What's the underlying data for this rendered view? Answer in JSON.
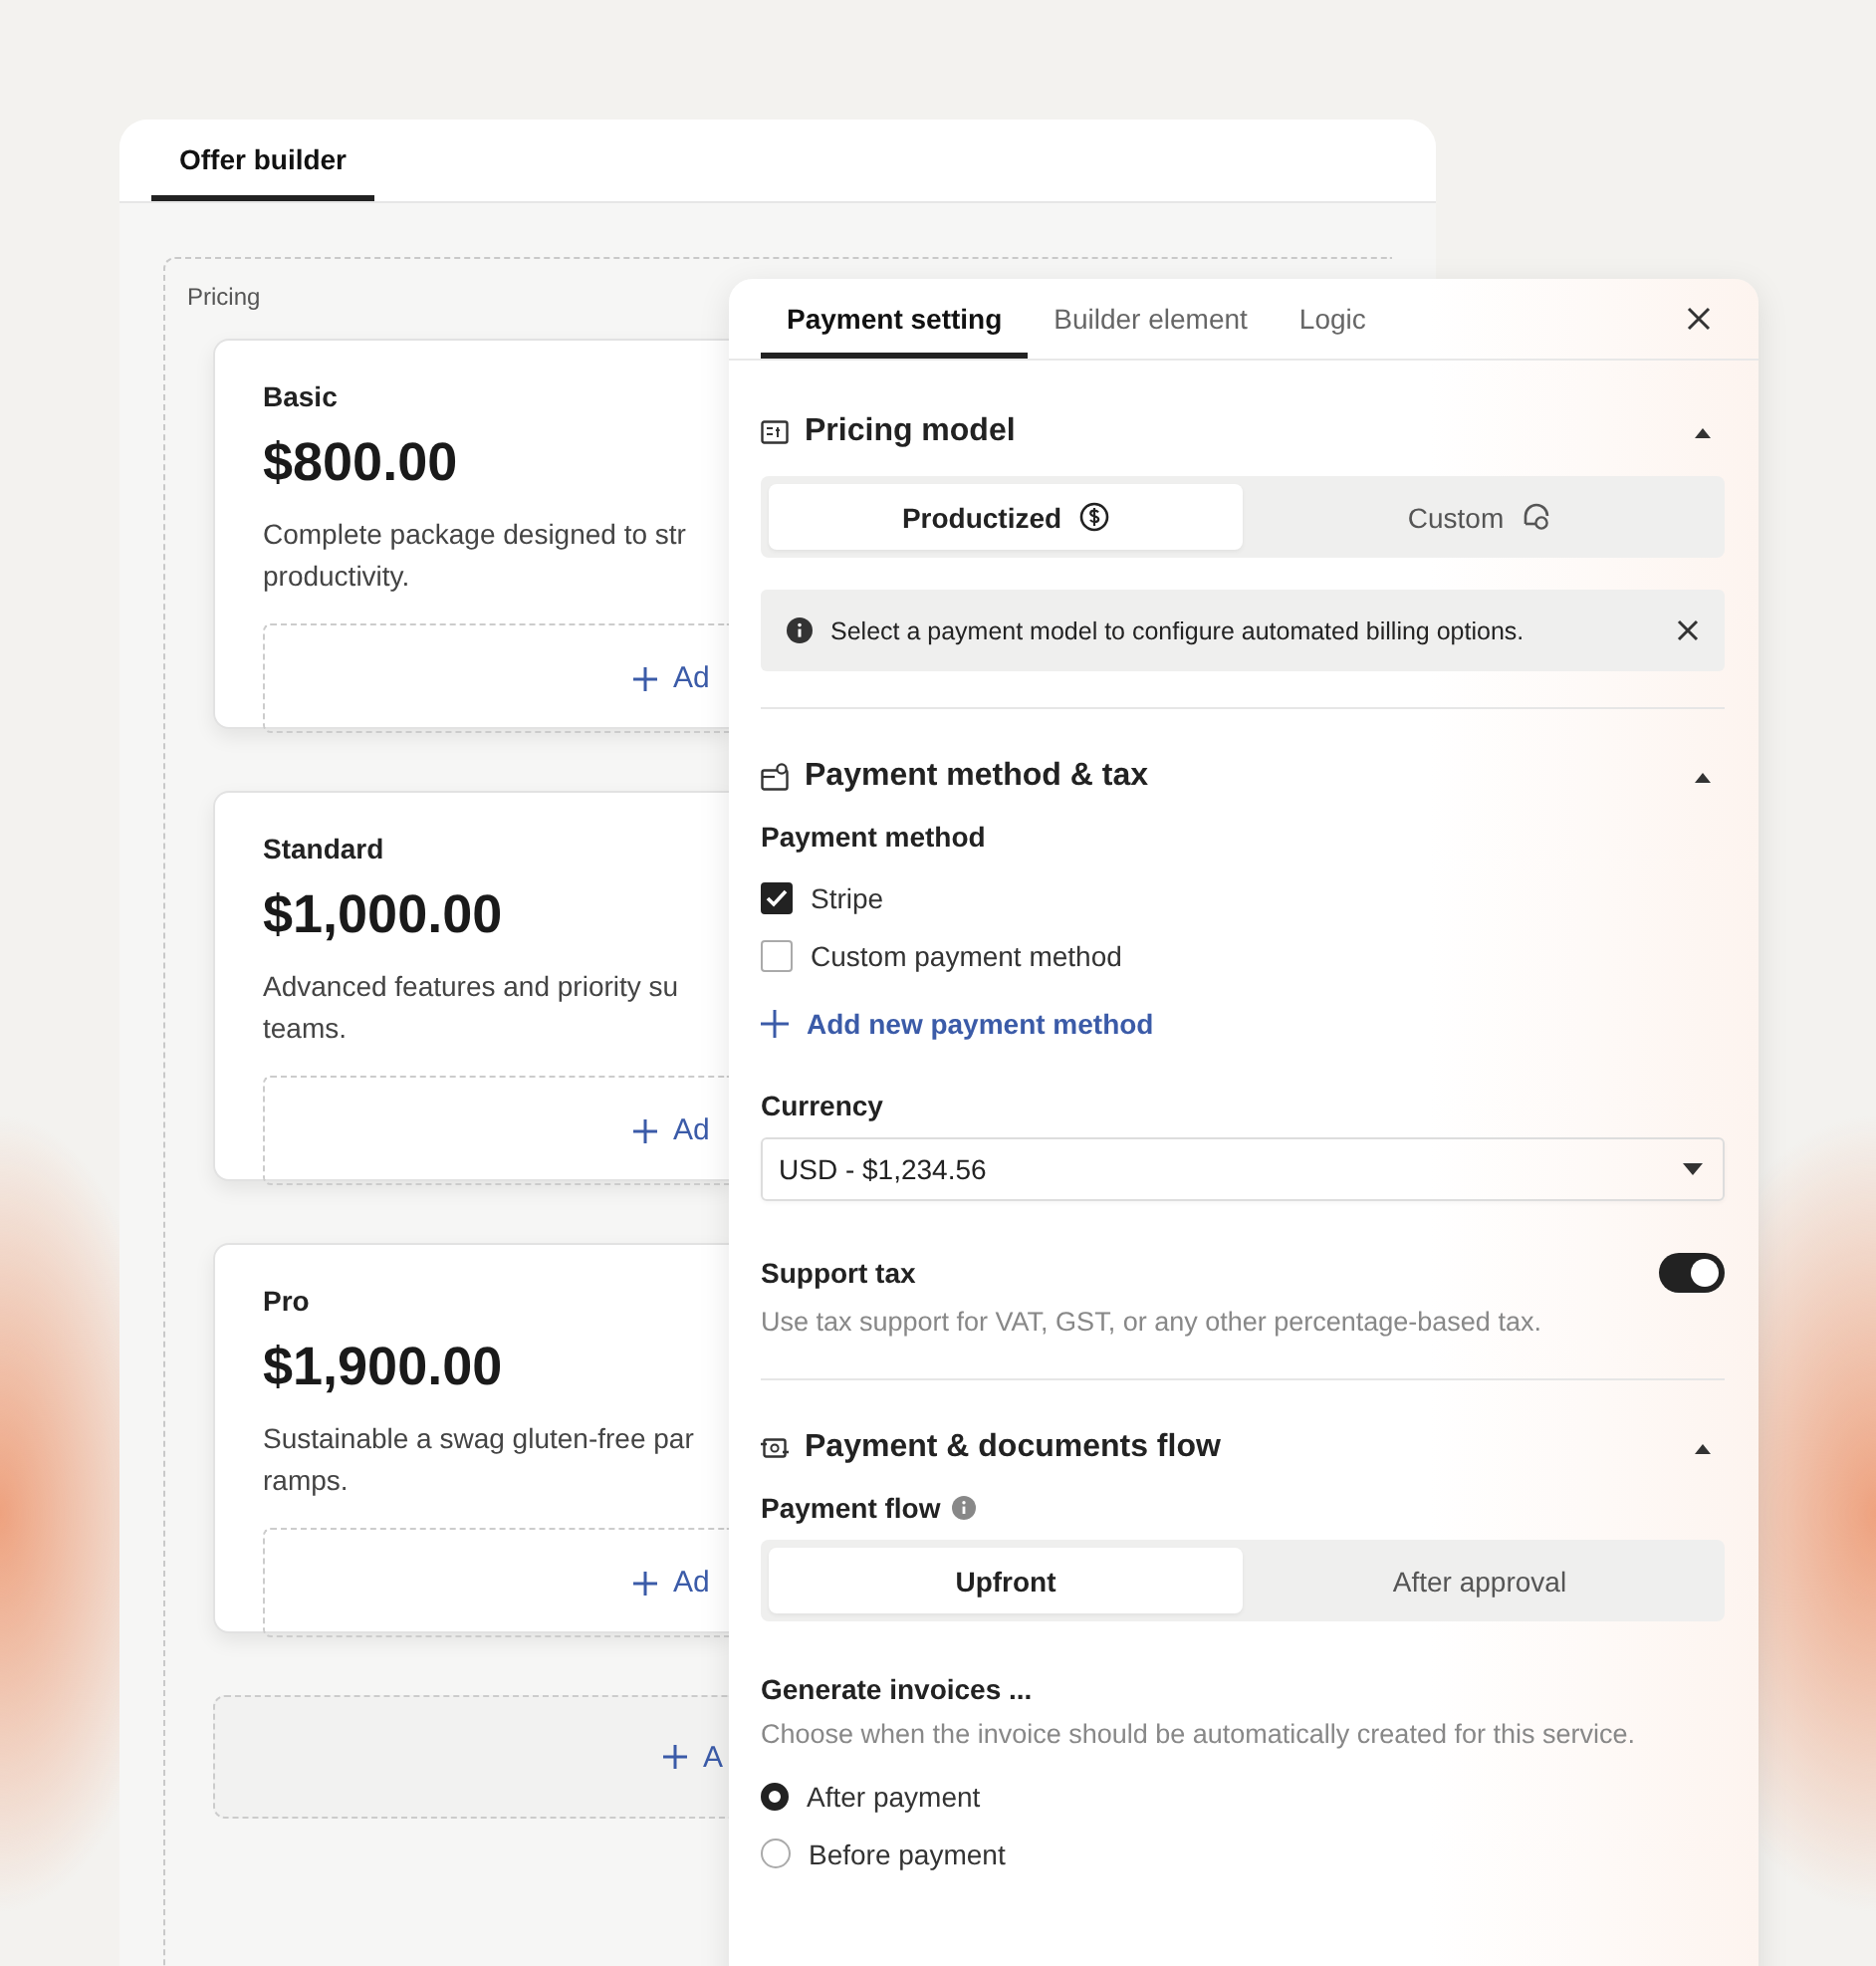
{
  "builder": {
    "tabs": [
      {
        "label": "Offer builder",
        "selected": true
      }
    ],
    "section_label": "Pricing",
    "plans": [
      {
        "name": "Basic",
        "price": "$800.00",
        "description_lines": [
          "Complete package designed to str",
          "productivity."
        ],
        "add_label": "Ad"
      },
      {
        "name": "Standard",
        "price": "$1,000.00",
        "description_lines": [
          "Advanced features and priority su",
          "teams."
        ],
        "add_label": "Ad"
      },
      {
        "name": "Pro",
        "price": "$1,900.00",
        "description_lines": [
          "Sustainable a swag gluten-free par",
          "ramps."
        ],
        "add_label": "Ad"
      }
    ],
    "add_plan_label": "A"
  },
  "panel": {
    "tabs": [
      {
        "label": "Payment setting",
        "selected": true
      },
      {
        "label": "Builder element",
        "selected": false
      },
      {
        "label": "Logic",
        "selected": false
      }
    ],
    "pricing_model": {
      "title": "Pricing model",
      "expanded": true,
      "options": [
        {
          "label": "Productized",
          "selected": true
        },
        {
          "label": "Custom",
          "selected": false
        }
      ],
      "notice": "Select a payment model to configure automated billing options."
    },
    "payment_method": {
      "title": "Payment method & tax",
      "expanded": true,
      "method_label": "Payment method",
      "methods": [
        {
          "label": "Stripe",
          "checked": true
        },
        {
          "label": "Custom payment method",
          "checked": false
        }
      ],
      "add_method": "Add new payment method",
      "currency_label": "Currency",
      "currency_value": "USD - $1,234.56",
      "tax_label": "Support tax",
      "tax_on": true,
      "tax_hint": "Use tax support for VAT, GST, or any other percentage-based tax."
    },
    "flow": {
      "title": "Payment & documents flow",
      "expanded": true,
      "flow_label": "Payment flow",
      "flow_options": [
        {
          "label": "Upfront",
          "selected": true
        },
        {
          "label": "After approval",
          "selected": false
        }
      ],
      "invoice_label": "Generate invoices ...",
      "invoice_hint": "Choose when the invoice should be automatically created for this service.",
      "invoice_options": [
        {
          "label": "After payment",
          "selected": true
        },
        {
          "label": "Before payment",
          "selected": false
        }
      ]
    }
  }
}
